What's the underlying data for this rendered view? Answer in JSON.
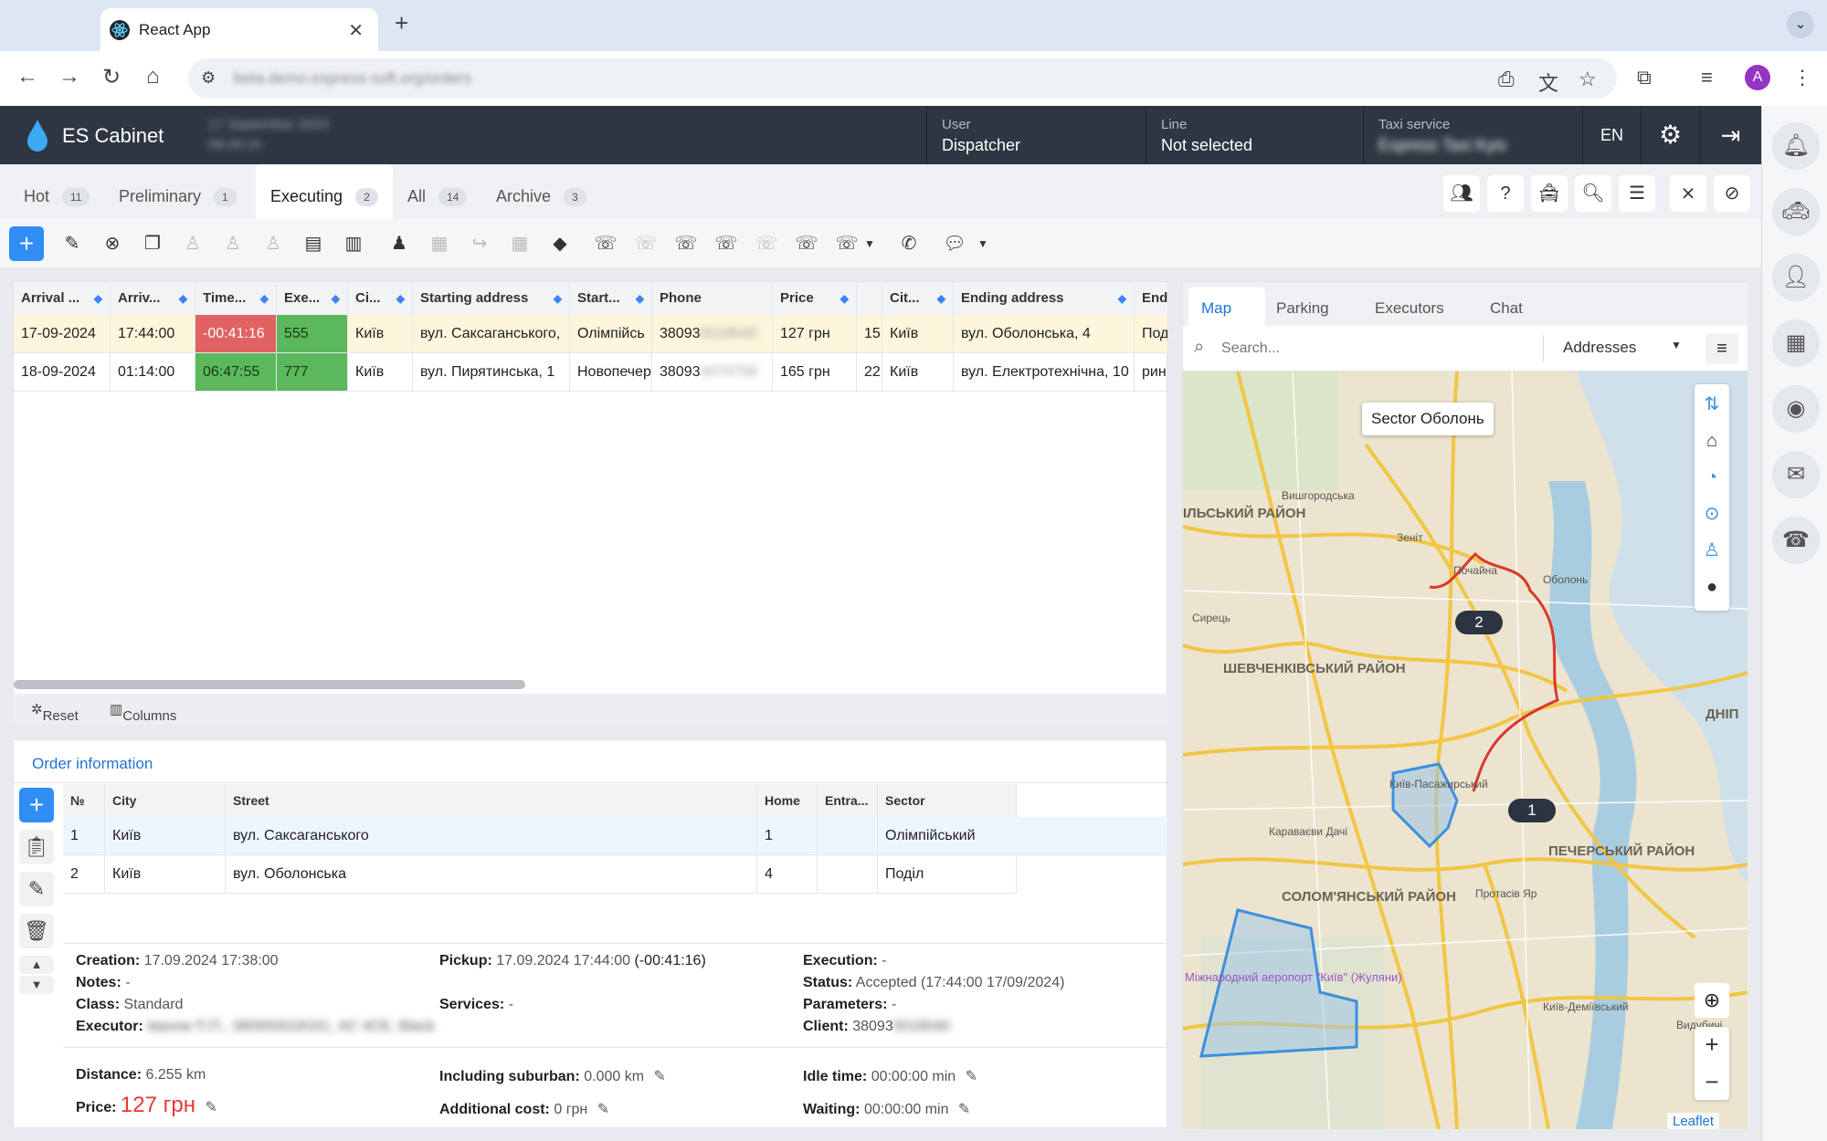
{
  "browser": {
    "tab_title": "React App",
    "url": "beta.demo.express-soft.org/orders",
    "avatar_letter": "A"
  },
  "header": {
    "brand": "ES Cabinet",
    "datetime_date": "17 September 2024",
    "datetime_time": "08:26:15",
    "user_label": "User",
    "user_value": "Dispatcher",
    "line_label": "Line",
    "line_value": "Not selected",
    "service_label": "Taxi service",
    "service_value": "Express Taxi Kyiv",
    "lang": "EN"
  },
  "order_tabs": [
    {
      "label": "Hot",
      "count": "11"
    },
    {
      "label": "Preliminary",
      "count": "1"
    },
    {
      "label": "Executing",
      "count": "2"
    },
    {
      "label": "All",
      "count": "14"
    },
    {
      "label": "Archive",
      "count": "3"
    }
  ],
  "grid": {
    "columns": [
      "Arrival ...",
      "Arriv...",
      "Time...",
      "Exe...",
      "Ci...",
      "Starting address",
      "Start...",
      "Phone",
      "Price",
      "",
      "Cit...",
      "Ending address",
      "Endi"
    ],
    "rows": [
      [
        "17-09-2024",
        "17:44:00",
        "-00:41:16",
        "555",
        "Київ",
        "вул. Саксаганського,",
        "Олімпійсь",
        "38093",
        "127 грн",
        "15",
        "Київ",
        "вул. Оболонська, 4",
        "Под"
      ],
      [
        "18-09-2024",
        "01:14:00",
        "06:47:55",
        "777",
        "Київ",
        "вул. Пирятинська, 1",
        "Новопечер",
        "38093",
        "165 грн",
        "22",
        "Київ",
        "вул. Електротехнічна, 10",
        "рин"
      ]
    ],
    "phone_hidden": [
      "5518540",
      "4474758"
    ],
    "reset_label": "Reset",
    "columns_label": "Columns"
  },
  "order_info": {
    "tab_label": "Order information",
    "columns": [
      "№",
      "City",
      "Street",
      "Home",
      "Entra...",
      "Sector"
    ],
    "rows": [
      [
        "1",
        "Київ",
        "вул. Саксаганського",
        "1",
        "",
        "Олімпійський"
      ],
      [
        "2",
        "Київ",
        "вул. Оболонська",
        "4",
        "",
        "Поділ"
      ]
    ],
    "creation_label": "Creation:",
    "creation_value": "17.09.2024 17:38:00",
    "notes_label": "Notes:",
    "notes_value": "-",
    "class_label": "Class:",
    "class_value": "Standard",
    "executor_label": "Executor:",
    "executor_value": "Іванов П.П., 380950018161, AC 4CE, Black",
    "pickup_label": "Pickup:",
    "pickup_value": "17.09.2024 17:44:00",
    "pickup_delta": "(-00:41:16)",
    "services_label": "Services:",
    "services_value": "-",
    "execution_label": "Execution:",
    "execution_value": "-",
    "status_label": "Status:",
    "status_value": "Accepted (17:44:00 17/09/2024)",
    "parameters_label": "Parameters:",
    "parameters_value": "-",
    "client_label": "Client:",
    "client_value": "38093",
    "client_hidden": "5518540",
    "distance_label": "Distance:",
    "distance_value": "6.255 km",
    "price_label": "Price:",
    "price_value": "127 грн",
    "suburban_label": "Including suburban:",
    "suburban_value": "0.000 km",
    "additional_label": "Additional cost:",
    "additional_value": "0 грн",
    "idle_label": "Idle time:",
    "idle_value": "00:00:00 min",
    "waiting_label": "Waiting:",
    "waiting_value": "00:00:00 min"
  },
  "map": {
    "tabs": [
      "Map",
      "Parking",
      "Executors",
      "Chat"
    ],
    "search_placeholder": "Search...",
    "dropdown_value": "Addresses",
    "tooltip": "Sector Оболонь",
    "marker_1": "1",
    "marker_2": "2",
    "labels": [
      "ІЛЬСЬКИЙ РАЙОН",
      "ШЕВЧЕНКІВСЬКИЙ РАЙОН",
      "СОЛОМ'ЯНСЬКИЙ РАЙОН",
      "ПЕЧЕРСЬКИЙ РАЙОН",
      "ДНІП",
      "Міжнародний аеропорт \"Київ\" (Жуляни)",
      "Вишгородська",
      "Оболонь",
      "Почайна",
      "Зеніт",
      "Сирець",
      "Київ-Пасажирський",
      "Караваєви Дачі",
      "Протасів Яр",
      "Київ-Деміївський",
      "Видубичі"
    ],
    "attribution": "Leaflet",
    "accent_route": "#d9372b",
    "accent_sector": "#3d8fe0"
  },
  "colors": {
    "accent": "#2f8df5",
    "late": "#e06262",
    "ok": "#5cb85c",
    "row_highlight": "#fdf6dc"
  }
}
